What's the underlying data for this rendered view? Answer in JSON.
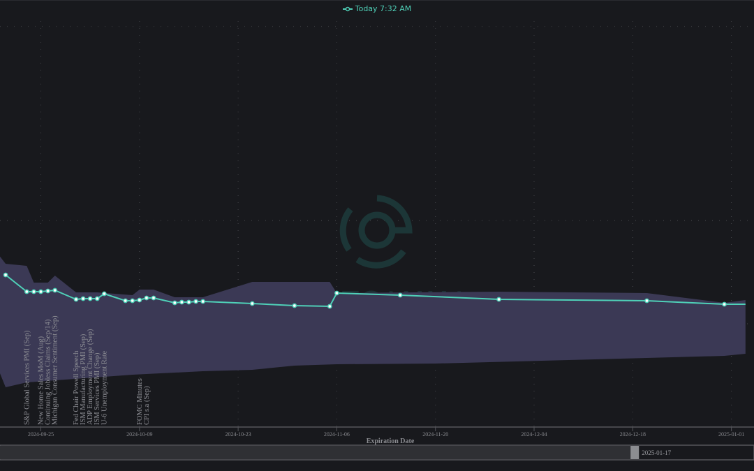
{
  "legend": {
    "label": "Today 7:32 AM",
    "color": "#4fd1b8"
  },
  "watermark": {
    "text": "SPOTGAMMA",
    "color": "#1f3f3e"
  },
  "colors": {
    "background": "#18191d",
    "band": "#3b3955",
    "line": "#4fd1b8",
    "grid": "#4a4b50"
  },
  "chart_data": {
    "type": "line",
    "xlabel": "Expiration Date",
    "ylabel": "",
    "xlim": [
      "2024-09-19",
      "2025-01-03"
    ],
    "ylim": [
      0,
      61.2
    ],
    "grid": true,
    "y_gridlines": [
      57.4,
      29.6,
      14.8
    ],
    "x_ticks": [
      "2024-09-25",
      "2024-10-09",
      "2024-10-23",
      "2024-11-06",
      "2024-11-20",
      "2024-12-04",
      "2024-12-18",
      "2025-01-01"
    ],
    "series": [
      {
        "name": "Today 7:32 AM",
        "points": [
          [
            "2024-09-20",
            21.8
          ],
          [
            "2024-09-23",
            19.4
          ],
          [
            "2024-09-24",
            19.4
          ],
          [
            "2024-09-25",
            19.4
          ],
          [
            "2024-09-26",
            19.5
          ],
          [
            "2024-09-27",
            19.6
          ],
          [
            "2024-09-30",
            18.3
          ],
          [
            "2024-10-01",
            18.4
          ],
          [
            "2024-10-02",
            18.4
          ],
          [
            "2024-10-03",
            18.4
          ],
          [
            "2024-10-04",
            19.1
          ],
          [
            "2024-10-07",
            18.1
          ],
          [
            "2024-10-08",
            18.1
          ],
          [
            "2024-10-09",
            18.2
          ],
          [
            "2024-10-10",
            18.5
          ],
          [
            "2024-10-11",
            18.5
          ],
          [
            "2024-10-14",
            17.8
          ],
          [
            "2024-10-15",
            17.9
          ],
          [
            "2024-10-16",
            17.9
          ],
          [
            "2024-10-17",
            18.0
          ],
          [
            "2024-10-18",
            18.0
          ],
          [
            "2024-10-25",
            17.7
          ],
          [
            "2024-10-31",
            17.4
          ],
          [
            "2024-11-05",
            17.3
          ],
          [
            "2024-11-06",
            19.2
          ],
          [
            "2024-11-15",
            18.9
          ],
          [
            "2024-11-29",
            18.3
          ],
          [
            "2024-12-20",
            18.1
          ],
          [
            "2024-12-31",
            17.6
          ],
          [
            "2025-01-03",
            17.6
          ]
        ]
      }
    ],
    "band": {
      "upper": [
        [
          "2024-09-19",
          24.7
        ],
        [
          "2024-09-20",
          23.4
        ],
        [
          "2024-09-23",
          23.1
        ],
        [
          "2024-09-24",
          20.7
        ],
        [
          "2024-09-26",
          20.7
        ],
        [
          "2024-09-27",
          21.7
        ],
        [
          "2024-09-30",
          19.3
        ],
        [
          "2024-10-03",
          19.3
        ],
        [
          "2024-10-08",
          18.9
        ],
        [
          "2024-10-09",
          19.7
        ],
        [
          "2024-10-11",
          19.7
        ],
        [
          "2024-10-14",
          18.6
        ],
        [
          "2024-10-18",
          18.6
        ],
        [
          "2024-10-25",
          20.8
        ],
        [
          "2024-11-05",
          20.8
        ],
        [
          "2024-11-06",
          19.2
        ],
        [
          "2024-11-29",
          19.4
        ],
        [
          "2024-12-20",
          19.2
        ],
        [
          "2024-12-31",
          17.8
        ],
        [
          "2025-01-03",
          18.2
        ]
      ],
      "lower": [
        [
          "2024-09-19",
          8.2
        ],
        [
          "2024-09-20",
          5.7
        ],
        [
          "2024-09-23",
          6.4
        ],
        [
          "2024-10-04",
          7.2
        ],
        [
          "2024-10-08",
          7.5
        ],
        [
          "2024-10-18",
          8.0
        ],
        [
          "2024-10-25",
          8.2
        ],
        [
          "2024-10-31",
          8.8
        ],
        [
          "2024-11-06",
          9.0
        ],
        [
          "2024-11-20",
          9.1
        ],
        [
          "2024-12-20",
          9.9
        ],
        [
          "2024-12-31",
          10.2
        ],
        [
          "2025-01-03",
          10.5
        ]
      ]
    },
    "events": [
      {
        "date": "2024-09-23",
        "label": "S&P Global Services PMI (Sep)"
      },
      {
        "date": "2024-09-25",
        "label": "New Home Sales MoM (Aug)"
      },
      {
        "date": "2024-09-26",
        "label": "Continuing Jobless Claims (Sep/14)"
      },
      {
        "date": "2024-09-27",
        "label": "Michigan Consumer Sentiment (Sep)"
      },
      {
        "date": "2024-09-30",
        "label": "Fed Chair Powell Speech"
      },
      {
        "date": "2024-10-01",
        "label": "ISM Manufacturing PMI (Sep)"
      },
      {
        "date": "2024-10-02",
        "label": "ADP Employment Change (Sep)"
      },
      {
        "date": "2024-10-03",
        "label": "ISM Services PMI (Sep)"
      },
      {
        "date": "2024-10-04",
        "label": "U-6 Unemployment Rate"
      },
      {
        "date": "2024-10-09",
        "label": "FOMC Minutes"
      },
      {
        "date": "2024-10-10",
        "label": "CPI s.a (Sep)"
      }
    ]
  },
  "navigator": {
    "end_label": "2025-01-17",
    "selected_fraction": 0.84
  }
}
